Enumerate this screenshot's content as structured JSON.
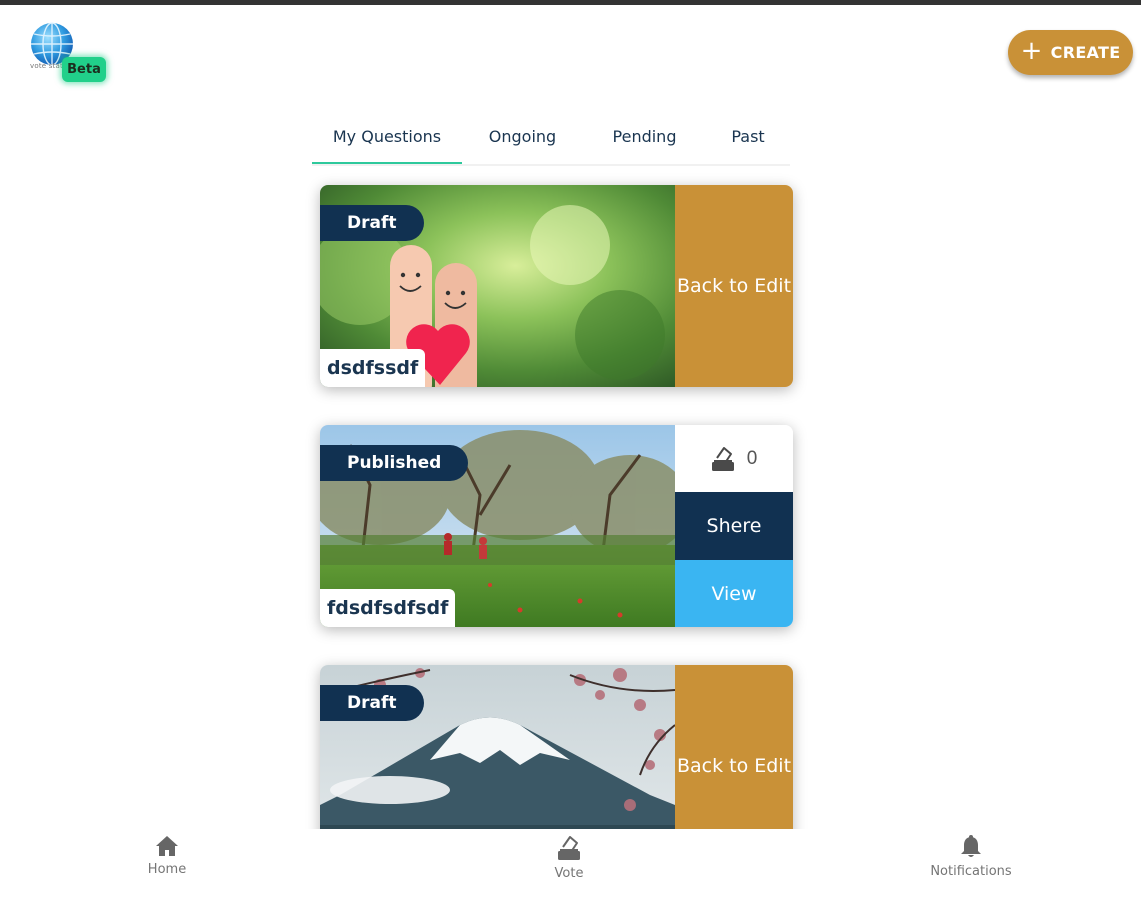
{
  "header": {
    "logo_badge": "Beta",
    "logo_tiny_text": "vote stat",
    "create_label": "CREATE",
    "create_icon": "plus-icon"
  },
  "tabs": [
    {
      "label": "My Questions",
      "active": true
    },
    {
      "label": "Ongoing",
      "active": false
    },
    {
      "label": "Pending",
      "active": false
    },
    {
      "label": "Past",
      "active": false
    }
  ],
  "cards": [
    {
      "status": "Draft",
      "title": "dsdfssdf",
      "action": "Back to Edit",
      "image": "finger-couple-heart"
    },
    {
      "status": "Published",
      "title": "fdsdfsdfsdf",
      "votes": "0",
      "share_label": "Shere",
      "view_label": "View",
      "image": "forest-cyclists"
    },
    {
      "status": "Draft",
      "title": "",
      "action": "Back to Edit",
      "image": "mount-fuji-blossoms"
    }
  ],
  "bottom_nav": [
    {
      "label": "Home",
      "icon": "home-icon"
    },
    {
      "label": "Vote",
      "icon": "ballot-box-icon"
    },
    {
      "label": "Notifications",
      "icon": "bell-icon"
    }
  ],
  "colors": {
    "accent_gold": "#c99137",
    "navy": "#113151",
    "view_blue": "#3ab5f2",
    "tab_indicator": "#2ec99c",
    "beta_green": "#21d08a"
  }
}
